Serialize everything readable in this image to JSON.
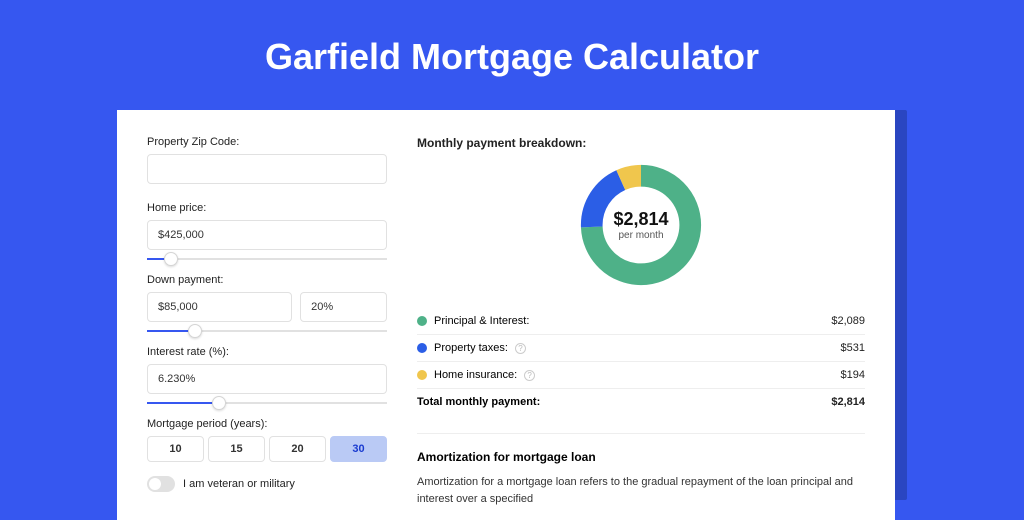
{
  "header": {
    "title": "Garfield Mortgage Calculator"
  },
  "form": {
    "zip": {
      "label": "Property Zip Code:",
      "value": ""
    },
    "home_price": {
      "label": "Home price:",
      "value": "$425,000",
      "slider_pct": 10
    },
    "down_payment": {
      "label": "Down payment:",
      "amount": "$85,000",
      "pct": "20%",
      "slider_pct": 20
    },
    "interest": {
      "label": "Interest rate (%):",
      "value": "6.230%",
      "slider_pct": 30
    },
    "period": {
      "label": "Mortgage period (years):",
      "options": [
        "10",
        "15",
        "20",
        "30"
      ],
      "active_index": 3
    },
    "veteran": {
      "label": "I am veteran or military",
      "value": false
    }
  },
  "breakdown": {
    "header": "Monthly payment breakdown:",
    "donut": {
      "amount": "$2,814",
      "sub": "per month"
    },
    "rows": [
      {
        "color": "green",
        "label": "Principal & Interest:",
        "info": false,
        "value": "$2,089"
      },
      {
        "color": "blue",
        "label": "Property taxes:",
        "info": true,
        "value": "$531"
      },
      {
        "color": "yellow",
        "label": "Home insurance:",
        "info": true,
        "value": "$194"
      }
    ],
    "total": {
      "label": "Total monthly payment:",
      "value": "$2,814"
    }
  },
  "amort": {
    "heading": "Amortization for mortgage loan",
    "body": "Amortization for a mortgage loan refers to the gradual repayment of the loan principal and interest over a specified"
  },
  "chart_data": {
    "type": "pie",
    "title": "Monthly payment breakdown",
    "series": [
      {
        "name": "Principal & Interest",
        "value": 2089,
        "color": "#4eb188"
      },
      {
        "name": "Property taxes",
        "value": 531,
        "color": "#2b5ee6"
      },
      {
        "name": "Home insurance",
        "value": 194,
        "color": "#f0c64d"
      }
    ],
    "total": 2814,
    "unit": "USD/month"
  }
}
